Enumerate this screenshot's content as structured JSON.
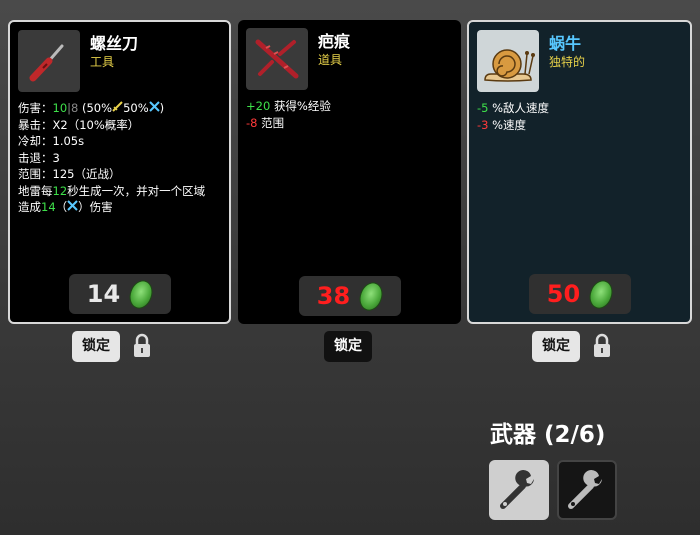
{
  "cards": [
    {
      "title": "螺丝刀",
      "type": "工具",
      "stats": {
        "damage_label": "伤害：",
        "damage_main": "10",
        "damage_sep": "|",
        "damage_base": "8",
        "damage_scale_open": "(50%",
        "damage_scale_mid": "50%",
        "damage_scale_close": ")",
        "crit": "暴击：X2（10%概率）",
        "cooldown": "冷却：1.05s",
        "knockback": "击退：3",
        "range": "范围：125（近战）",
        "mine_1": "地雷每",
        "mine_2": "12",
        "mine_3": "秒生成一次，并对一个区域",
        "mine_4": "造成",
        "mine_5": "14",
        "mine_6": "（",
        "mine_7": "）伤害"
      },
      "price": "14",
      "lock_label": "锁定"
    },
    {
      "title": "疤痕",
      "type": "道具",
      "effects": [
        {
          "value": "+20",
          "text": "获得%经验"
        },
        {
          "value": "-8",
          "text": "范围"
        }
      ],
      "price": "38",
      "lock_label": "锁定"
    },
    {
      "title": "蜗牛",
      "type": "独特的",
      "effects": [
        {
          "value": "-5",
          "text": "%敌人速度"
        },
        {
          "value": "-3",
          "text": "%速度"
        }
      ],
      "price": "50",
      "lock_label": "锁定"
    }
  ],
  "weapons": {
    "title": "武器 (2/6)"
  },
  "colors": {
    "positive": "#3ee04a",
    "negative": "#ff3a3a",
    "type_text": "#e8d24a",
    "unique_title": "#58c8ff",
    "price_red": "#ff1e1e"
  },
  "icons": [
    "screwdriver-icon",
    "scar-icon",
    "snail-icon",
    "coin-icon",
    "padlock-icon",
    "wrench-icon",
    "sword-icon",
    "crossed-tools-icon"
  ]
}
